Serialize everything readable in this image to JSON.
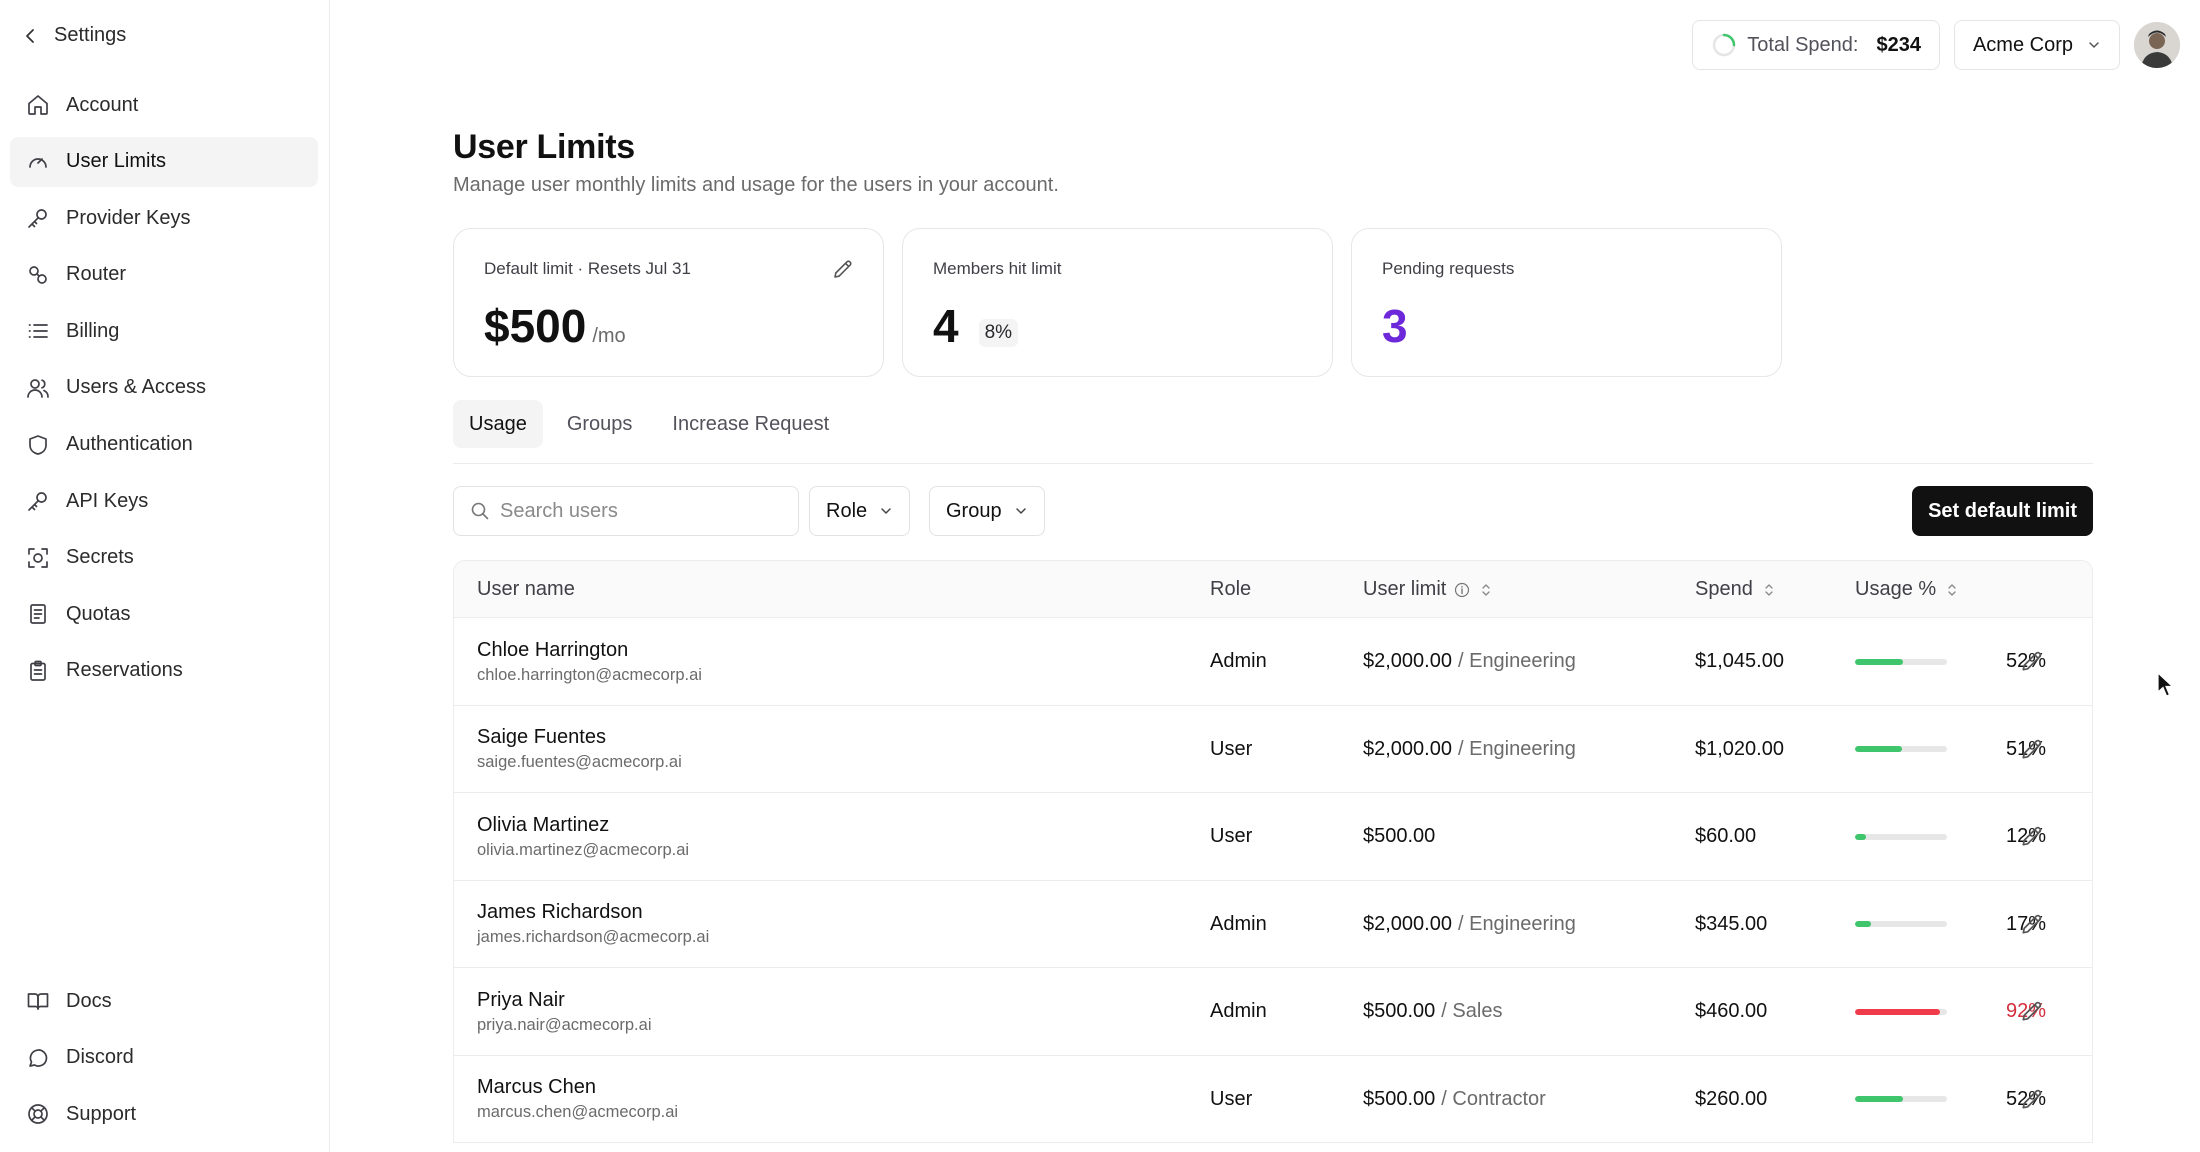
{
  "sidebar": {
    "back_label": "Settings",
    "items": [
      {
        "label": "Account",
        "icon": "home-icon",
        "active": false
      },
      {
        "label": "User Limits",
        "icon": "gauge-icon",
        "active": true
      },
      {
        "label": "Provider Keys",
        "icon": "key-icon",
        "active": false
      },
      {
        "label": "Router",
        "icon": "router-icon",
        "active": false
      },
      {
        "label": "Billing",
        "icon": "list-icon",
        "active": false
      },
      {
        "label": "Users & Access",
        "icon": "users-icon",
        "active": false
      },
      {
        "label": "Authentication",
        "icon": "shield-icon",
        "active": false
      },
      {
        "label": "API Keys",
        "icon": "key-icon",
        "active": false
      },
      {
        "label": "Secrets",
        "icon": "secret-icon",
        "active": false
      },
      {
        "label": "Quotas",
        "icon": "document-icon",
        "active": false
      },
      {
        "label": "Reservations",
        "icon": "clipboard-icon",
        "active": false
      }
    ],
    "bottom_items": [
      {
        "label": "Docs",
        "icon": "book-icon"
      },
      {
        "label": "Discord",
        "icon": "chat-icon"
      },
      {
        "label": "Support",
        "icon": "lifebuoy-icon"
      }
    ]
  },
  "header": {
    "spend_label": "Total Spend:",
    "spend_value": "$234",
    "org_name": "Acme Corp"
  },
  "page": {
    "title": "User Limits",
    "subtitle": "Manage user monthly limits and usage for the users in your account."
  },
  "cards": {
    "default_limit": {
      "label": "Default limit · Resets Jul 31",
      "value": "$500",
      "unit": "/mo"
    },
    "members_hit": {
      "label": "Members hit limit",
      "value": "4",
      "badge": "8%"
    },
    "pending": {
      "label": "Pending requests",
      "value": "3",
      "color": "#6d28d9"
    }
  },
  "tabs": [
    {
      "label": "Usage",
      "active": true
    },
    {
      "label": "Groups",
      "active": false
    },
    {
      "label": "Increase Request",
      "active": false
    }
  ],
  "filters": {
    "search_placeholder": "Search users",
    "role_label": "Role",
    "group_label": "Group",
    "set_default_label": "Set default limit"
  },
  "table": {
    "columns": {
      "name": "User name",
      "role": "Role",
      "limit": "User limit",
      "spend": "Spend",
      "usage": "Usage %"
    },
    "rows": [
      {
        "name": "Chloe Harrington",
        "email": "chloe.harrington@acmecorp.ai",
        "role": "Admin",
        "limit": "$2,000.00",
        "group": "/ Engineering",
        "spend": "$1,045.00",
        "usage": 52,
        "usage_label": "52%"
      },
      {
        "name": "Saige Fuentes",
        "email": "saige.fuentes@acmecorp.ai",
        "role": "User",
        "limit": "$2,000.00",
        "group": "/ Engineering",
        "spend": "$1,020.00",
        "usage": 51,
        "usage_label": "51%"
      },
      {
        "name": "Olivia Martinez",
        "email": "olivia.martinez@acmecorp.ai",
        "role": "User",
        "limit": "$500.00",
        "group": "",
        "spend": "$60.00",
        "usage": 12,
        "usage_label": "12%"
      },
      {
        "name": "James Richardson",
        "email": "james.richardson@acmecorp.ai",
        "role": "Admin",
        "limit": "$2,000.00",
        "group": "/ Engineering",
        "spend": "$345.00",
        "usage": 17,
        "usage_label": "17%"
      },
      {
        "name": "Priya Nair",
        "email": "priya.nair@acmecorp.ai",
        "role": "Admin",
        "limit": "$500.00",
        "group": "/ Sales",
        "spend": "$460.00",
        "usage": 92,
        "usage_label": "92%"
      },
      {
        "name": "Marcus Chen",
        "email": "marcus.chen@acmecorp.ai",
        "role": "User",
        "limit": "$500.00",
        "group": "/ Contractor",
        "spend": "$260.00",
        "usage": 52,
        "usage_label": "52%"
      }
    ]
  },
  "colors": {
    "usage_ok": "#3fc56b",
    "usage_high": "#ef3b4a",
    "usage_high_text": "#d32f3f",
    "accent_purple": "#6d28d9"
  }
}
